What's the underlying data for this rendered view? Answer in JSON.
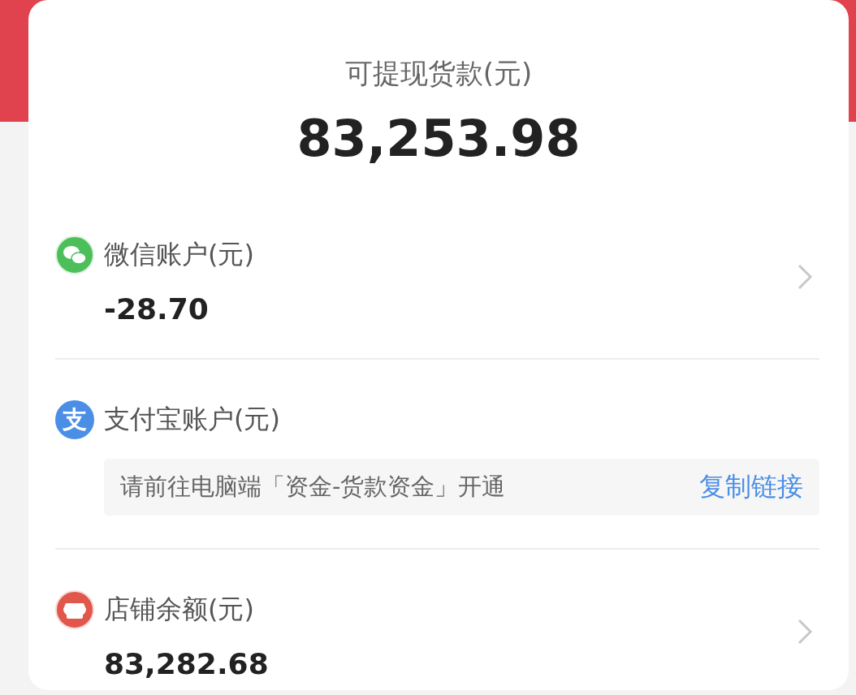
{
  "header": {
    "title": "可提现货款(元)",
    "amount": "83,253.98"
  },
  "accounts": [
    {
      "kind": "wechat",
      "label": "微信账户(元)",
      "value": "-28.70"
    },
    {
      "kind": "alipay",
      "icon_text": "支",
      "label": "支付宝账户(元)",
      "notice": "请前往电脑端「资金-货款资金」开通",
      "link": "复制链接"
    },
    {
      "kind": "store",
      "label": "店铺余额(元)",
      "value": "83,282.68"
    }
  ]
}
